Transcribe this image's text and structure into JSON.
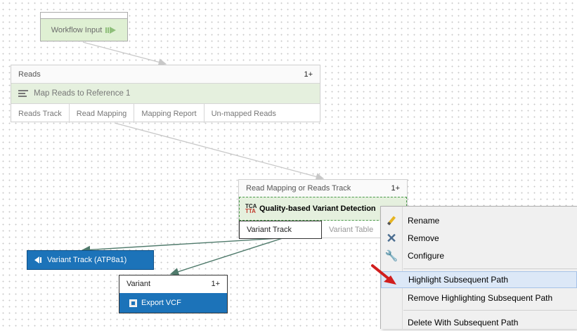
{
  "workflow_input": {
    "label": "Workflow Input"
  },
  "map_reads": {
    "input_label": "Reads",
    "input_count": "1+",
    "tool_name": "Map Reads to Reference 1",
    "outputs": [
      "Reads Track",
      "Read Mapping",
      "Mapping Report",
      "Un-mapped Reads"
    ]
  },
  "variant_detection": {
    "input_label": "Read Mapping or Reads Track",
    "input_count": "1+",
    "tool_name": "Quality-based Variant Detection",
    "outputs": [
      "Variant Track",
      "Variant Table"
    ]
  },
  "variant_track_output": {
    "label": "Variant Track (ATP8a1)"
  },
  "export_vcf": {
    "input_label": "Variant",
    "input_count": "1+",
    "tool_name": "Export VCF"
  },
  "context_menu": {
    "items": [
      {
        "label": "Rename",
        "icon": "pencil-icon"
      },
      {
        "label": "Remove",
        "icon": "remove-icon"
      },
      {
        "label": "Configure",
        "icon": "wrench-icon"
      },
      {
        "label": "Highlight Subsequent Path",
        "icon": ""
      },
      {
        "label": "Remove Highlighting Subsequent Path",
        "icon": ""
      },
      {
        "label": "Delete With Subsequent Path",
        "icon": ""
      }
    ]
  },
  "colors": {
    "tool_green": "#e5f0de",
    "output_blue": "#1c73b9",
    "connector_dark": "#4f7a6b",
    "connector_light": "#c8c8c8",
    "pointer_red": "#d11e1e"
  }
}
